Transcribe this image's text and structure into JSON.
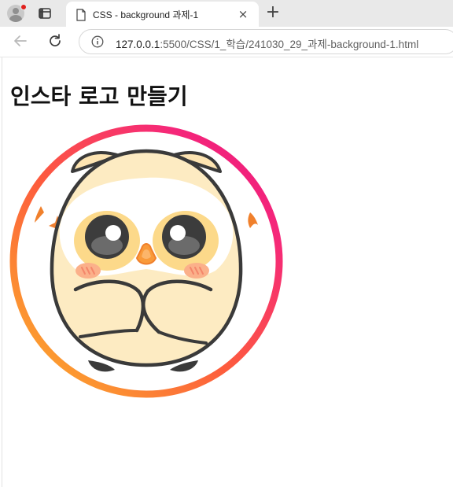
{
  "browser": {
    "tab": {
      "title": "CSS - background 과제-1",
      "close_icon": "×"
    },
    "new_tab_icon": "+",
    "address_bar": {
      "host": "127.0.0.1",
      "path": ":5500/CSS/1_학습/241030_29_과제-background-1.html"
    },
    "profile_badge_color": "#e0201c"
  },
  "page": {
    "heading": "인스타 로고 만들기",
    "logo": {
      "icon": "owl-character-icon",
      "ring_gradient": [
        "#fbb52a",
        "#fd5b3d",
        "#f5277a",
        "#e8127d"
      ]
    }
  }
}
